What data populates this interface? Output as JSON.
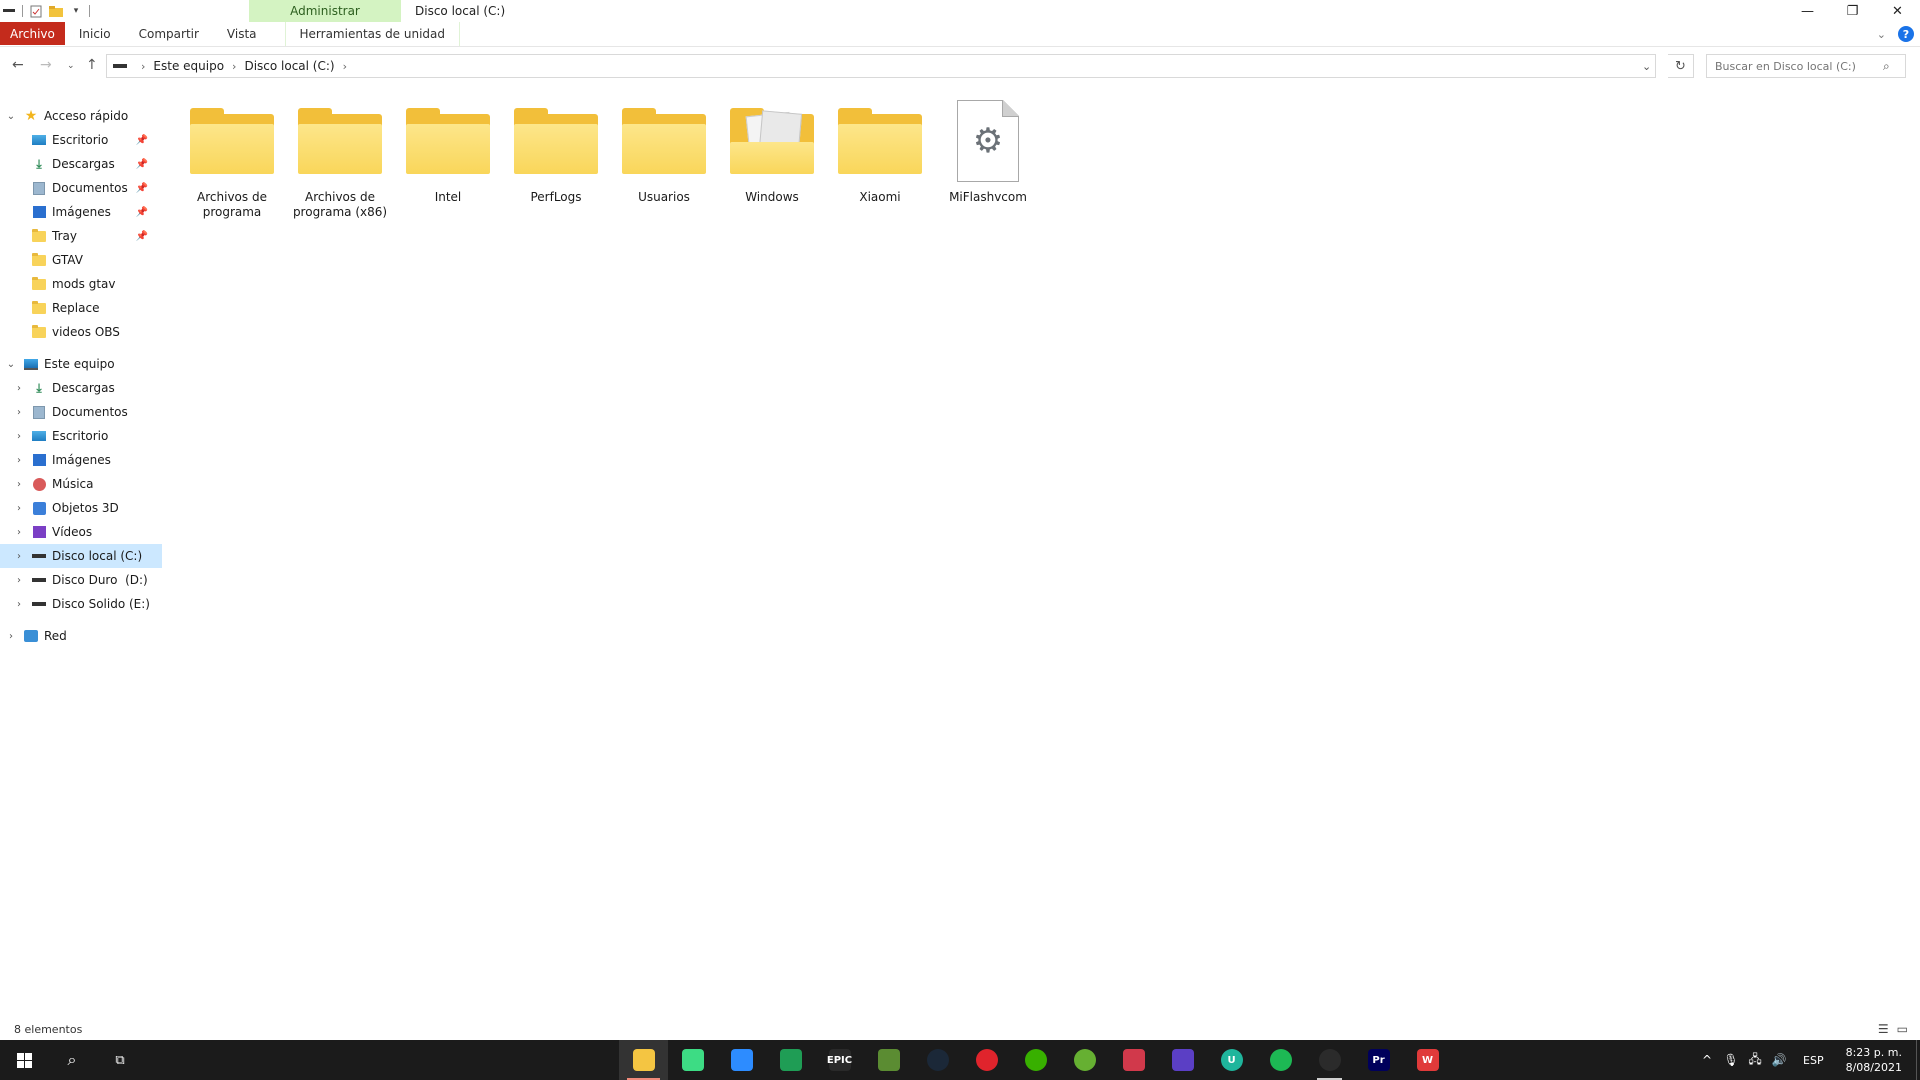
{
  "window": {
    "title": "Disco local (C:)",
    "context_group": "Administrar"
  },
  "quick_access_toolbar": [
    "properties-icon",
    "new-folder-icon",
    "customize-icon"
  ],
  "ribbon": {
    "tabs": [
      {
        "label": "Archivo"
      },
      {
        "label": "Inicio"
      },
      {
        "label": "Compartir"
      },
      {
        "label": "Vista"
      },
      {
        "label": "Herramientas de unidad"
      }
    ],
    "help": "?"
  },
  "address": {
    "breadcrumbs": [
      "Este equipo",
      "Disco local (C:)"
    ],
    "search_placeholder": "Buscar en Disco local (C:)"
  },
  "nav": {
    "quick_access": {
      "label": "Acceso rápido",
      "items": [
        {
          "label": "Escritorio",
          "icon": "desktop-icon",
          "pinned": true
        },
        {
          "label": "Descargas",
          "icon": "downloads-icon",
          "pinned": true
        },
        {
          "label": "Documentos",
          "icon": "documents-icon",
          "pinned": true
        },
        {
          "label": "Imágenes",
          "icon": "pictures-icon",
          "pinned": true
        },
        {
          "label": "Tray",
          "icon": "folder-icon",
          "pinned": true
        },
        {
          "label": "GTAV",
          "icon": "folder-icon",
          "pinned": false
        },
        {
          "label": "mods gtav",
          "icon": "folder-icon",
          "pinned": false
        },
        {
          "label": "Replace",
          "icon": "folder-icon",
          "pinned": false
        },
        {
          "label": "videos OBS",
          "icon": "folder-icon",
          "pinned": false
        }
      ]
    },
    "this_pc": {
      "label": "Este equipo",
      "items": [
        {
          "label": "Descargas",
          "icon": "downloads-icon"
        },
        {
          "label": "Documentos",
          "icon": "documents-icon"
        },
        {
          "label": "Escritorio",
          "icon": "desktop-icon"
        },
        {
          "label": "Imágenes",
          "icon": "pictures-icon"
        },
        {
          "label": "Música",
          "icon": "music-icon"
        },
        {
          "label": "Objetos 3D",
          "icon": "3d-objects-icon"
        },
        {
          "label": "Vídeos",
          "icon": "videos-icon"
        },
        {
          "label": "Disco local (C:)",
          "icon": "drive-icon",
          "selected": true
        },
        {
          "label": "Disco Duro  (D:)",
          "icon": "drive-icon"
        },
        {
          "label": "Disco Solido (E:)",
          "icon": "drive-icon"
        }
      ]
    },
    "network": {
      "label": "Red"
    }
  },
  "content": {
    "items": [
      {
        "label": "Archivos de programa",
        "type": "folder"
      },
      {
        "label": "Archivos de programa (x86)",
        "type": "folder"
      },
      {
        "label": "Intel",
        "type": "folder"
      },
      {
        "label": "PerfLogs",
        "type": "folder"
      },
      {
        "label": "Usuarios",
        "type": "folder"
      },
      {
        "label": "Windows",
        "type": "folder-with-files"
      },
      {
        "label": "Xiaomi",
        "type": "folder"
      },
      {
        "label": "MiFlashvcom",
        "type": "system-file"
      }
    ]
  },
  "status": {
    "item_count": "8 elementos"
  },
  "taskbar": {
    "apps": [
      {
        "name": "file-explorer",
        "active": true,
        "color": "#f4c542",
        "glyph": ""
      },
      {
        "name": "android-studio",
        "color": "#3ddc84",
        "glyph": ""
      },
      {
        "name": "zoom",
        "color": "#2d8cff",
        "glyph": ""
      },
      {
        "name": "launcher-green",
        "color": "#1f9d55",
        "glyph": ""
      },
      {
        "name": "epic-games",
        "color": "#2a2a2a",
        "glyph": "EPIC"
      },
      {
        "name": "minecraft",
        "color": "#5b8c32",
        "glyph": ""
      },
      {
        "name": "steam",
        "color": "#1b2838",
        "glyph": ""
      },
      {
        "name": "opera",
        "color": "#e0242c",
        "glyph": ""
      },
      {
        "name": "app-green-1",
        "color": "#38b000",
        "glyph": ""
      },
      {
        "name": "utorrent",
        "color": "#66b032",
        "glyph": ""
      },
      {
        "name": "app-tools",
        "color": "#d1394b",
        "glyph": ""
      },
      {
        "name": "app-purple",
        "color": "#5b3fc5",
        "glyph": ""
      },
      {
        "name": "app-teal-u",
        "color": "#1fb59c",
        "glyph": "U"
      },
      {
        "name": "spotify",
        "color": "#1db954",
        "glyph": ""
      },
      {
        "name": "obs",
        "color": "#2b2b2b",
        "running": true,
        "glyph": ""
      },
      {
        "name": "premiere-pro",
        "color": "#00005b",
        "glyph": "Pr"
      },
      {
        "name": "wps-office",
        "color": "#e03a3a",
        "glyph": "W"
      }
    ],
    "tray": {
      "language": "ESP",
      "time": "8:23 p. m.",
      "date": "8/08/2021"
    }
  }
}
